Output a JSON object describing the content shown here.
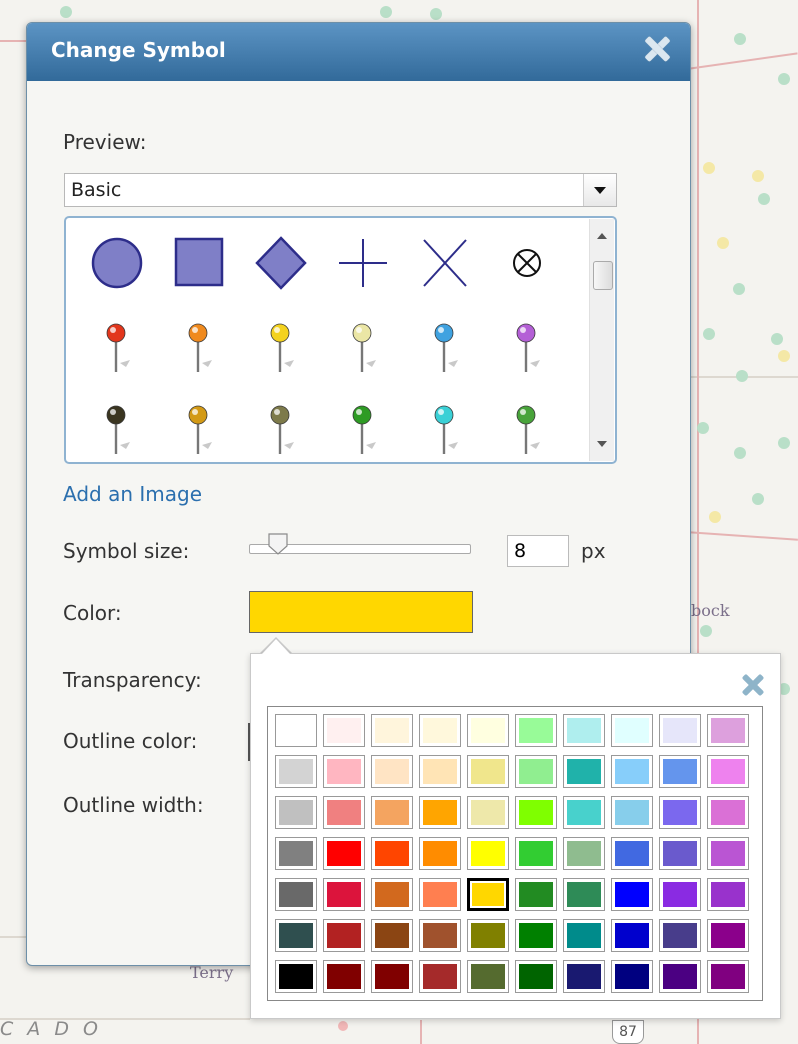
{
  "dialog": {
    "title": "Change Symbol",
    "preview_label": "Preview:",
    "symbol_set": "Basic",
    "add_image_link": "Add an Image",
    "symbol_size_label": "Symbol size:",
    "symbol_size_value": "8",
    "symbol_size_unit": "px",
    "color_label": "Color:",
    "color_value": "#FFD700",
    "transparency_label": "Transparency:",
    "outline_color_label": "Outline color:",
    "outline_width_label": "Outline width:"
  },
  "symbols": {
    "basic_shapes": [
      "circle-icon",
      "square-icon",
      "diamond-icon",
      "cross-icon",
      "x-icon",
      "circle-x-icon"
    ],
    "pushpin_row_1": [
      "#e2361c",
      "#f08a1e",
      "#f4d21e",
      "#ebe6a5",
      "#3fa2e0",
      "#b45fd6"
    ],
    "pushpin_row_2": [
      "#3a3520",
      "#d39a16",
      "#7d7a4a",
      "#2e9b24",
      "#3ad0d6",
      "#48a33a"
    ]
  },
  "map": {
    "labels": [
      "Terry",
      "bock",
      "87"
    ],
    "state_label": "C A D O"
  },
  "palette": {
    "colors": [
      [
        "#FFFFFF",
        "#FFF0F0",
        "#FFF5DC",
        "#FFF8DC",
        "#FFFFE0",
        "#98FB98",
        "#AFEEEE",
        "#E0FFFF",
        "#E6E6FA",
        "#DDA0DD"
      ],
      [
        "#D3D3D3",
        "#FFB6C1",
        "#FFE4C4",
        "#FFE4B5",
        "#F0E68C",
        "#90EE90",
        "#20B2AA",
        "#87CEFA",
        "#6495ED",
        "#EE82EE"
      ],
      [
        "#C0C0C0",
        "#F08080",
        "#F4A460",
        "#FFA500",
        "#EEE8AA",
        "#7FFF00",
        "#48D1CC",
        "#87CEEB",
        "#7B68EE",
        "#DA70D6"
      ],
      [
        "#808080",
        "#FF0000",
        "#FF4500",
        "#FF8C00",
        "#FFFF00",
        "#32CD32",
        "#8FBC8F",
        "#4169E1",
        "#6A5ACD",
        "#BA55D3"
      ],
      [
        "#696969",
        "#DC143C",
        "#D2691E",
        "#FF7F50",
        "#FFD700",
        "#228B22",
        "#2E8B57",
        "#0000FF",
        "#8A2BE2",
        "#9932CC"
      ],
      [
        "#2F4F4F",
        "#B22222",
        "#8B4513",
        "#A0522D",
        "#808000",
        "#008000",
        "#008B8B",
        "#0000CD",
        "#483D8B",
        "#8B008B"
      ],
      [
        "#000000",
        "#800000",
        "#800000",
        "#A52A2A",
        "#556B2F",
        "#006400",
        "#191970",
        "#000080",
        "#4B0082",
        "#800080"
      ]
    ],
    "selected": "#FFD700"
  }
}
